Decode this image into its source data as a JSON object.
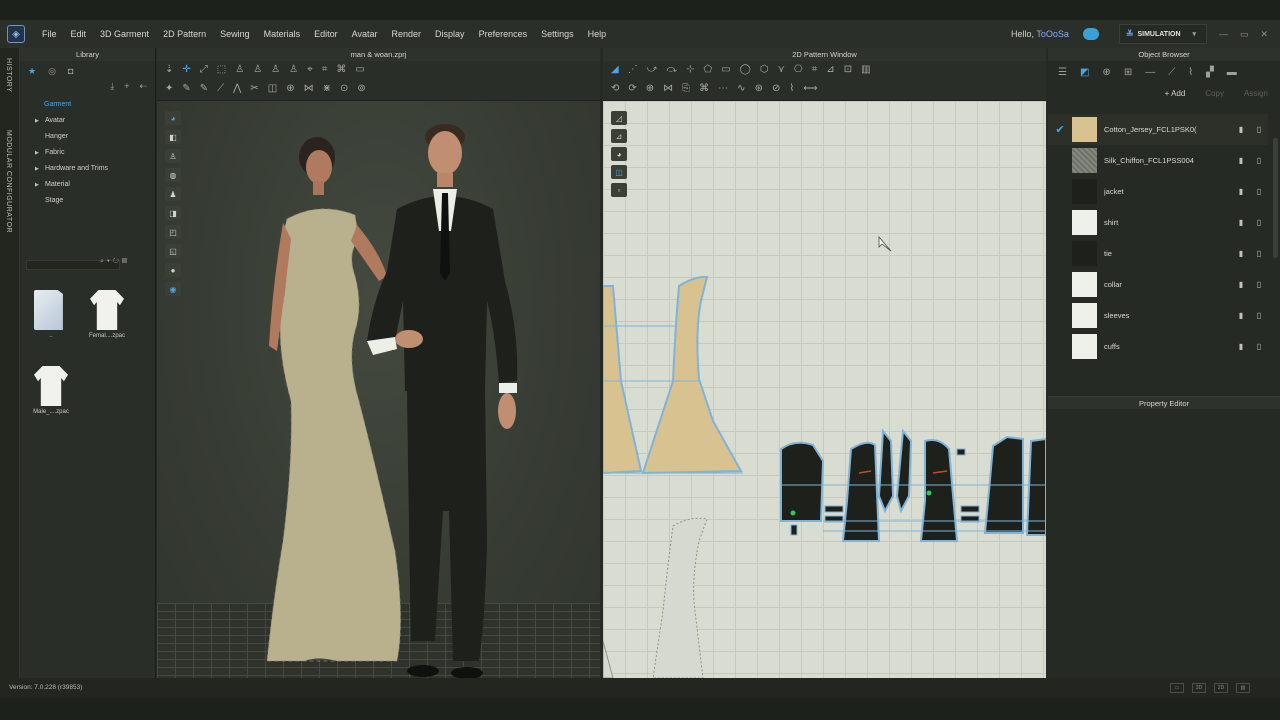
{
  "app": {
    "menu": [
      "File",
      "Edit",
      "3D Garment",
      "2D Pattern",
      "Sewing",
      "Materials",
      "Editor",
      "Avatar",
      "Render",
      "Display",
      "Preferences",
      "Settings",
      "Help"
    ],
    "greeting": "Hello,",
    "user": "ToOoSa",
    "mode_button": "SIMULATION",
    "version": "Version: 7.0.228 (r39853)"
  },
  "side_tabs": [
    "HISTORY",
    "MODULAR CONFIGURATOR"
  ],
  "library": {
    "title": "Library",
    "tree": [
      {
        "label": "Garment",
        "selected": true,
        "expandable": false
      },
      {
        "label": "Avatar",
        "selected": false,
        "expandable": true
      },
      {
        "label": "Hanger",
        "selected": false,
        "expandable": false
      },
      {
        "label": "Fabric",
        "selected": false,
        "expandable": true
      },
      {
        "label": "Hardware and Trims",
        "selected": false,
        "expandable": true
      },
      {
        "label": "Material",
        "selected": false,
        "expandable": true
      },
      {
        "label": "Stage",
        "selected": false,
        "expandable": false
      }
    ],
    "items": [
      {
        "label": "..",
        "icon": "folder-icon"
      },
      {
        "label": "Femal....zpac",
        "icon": "shirt-icon"
      },
      {
        "label": "Male_....zpac",
        "icon": "shirt-icon"
      }
    ]
  },
  "viewport3d": {
    "title": "man & woan.zprj"
  },
  "pattern2d": {
    "title": "2D Pattern Window"
  },
  "object_browser": {
    "title": "Object Browser",
    "add_label": "+ Add",
    "copy_label": "Copy",
    "assign_label": "Assign",
    "fabrics": [
      {
        "name": "Cotton_Jersey_FCL1PSK0(",
        "swatch": "#d8c290",
        "checked": true
      },
      {
        "name": "Silk_Chiffon_FCL1PSS004",
        "swatch": "#7a7d72",
        "checked": false
      },
      {
        "name": "jacket",
        "swatch": "#1d201b",
        "checked": false
      },
      {
        "name": "shirt",
        "swatch": "#eef0ea",
        "checked": false
      },
      {
        "name": "tie",
        "swatch": "#1d201b",
        "checked": false
      },
      {
        "name": "collar",
        "swatch": "#eef0ea",
        "checked": false
      },
      {
        "name": "sleeves",
        "swatch": "#eef0ea",
        "checked": false
      },
      {
        "name": "cuffs",
        "swatch": "#eef0ea",
        "checked": false
      }
    ]
  },
  "property_editor": {
    "title": "Property Editor"
  },
  "colors": {
    "accent": "#4aa6ea",
    "dress_fabric": "#d8c290",
    "suit": "#1d201b"
  }
}
